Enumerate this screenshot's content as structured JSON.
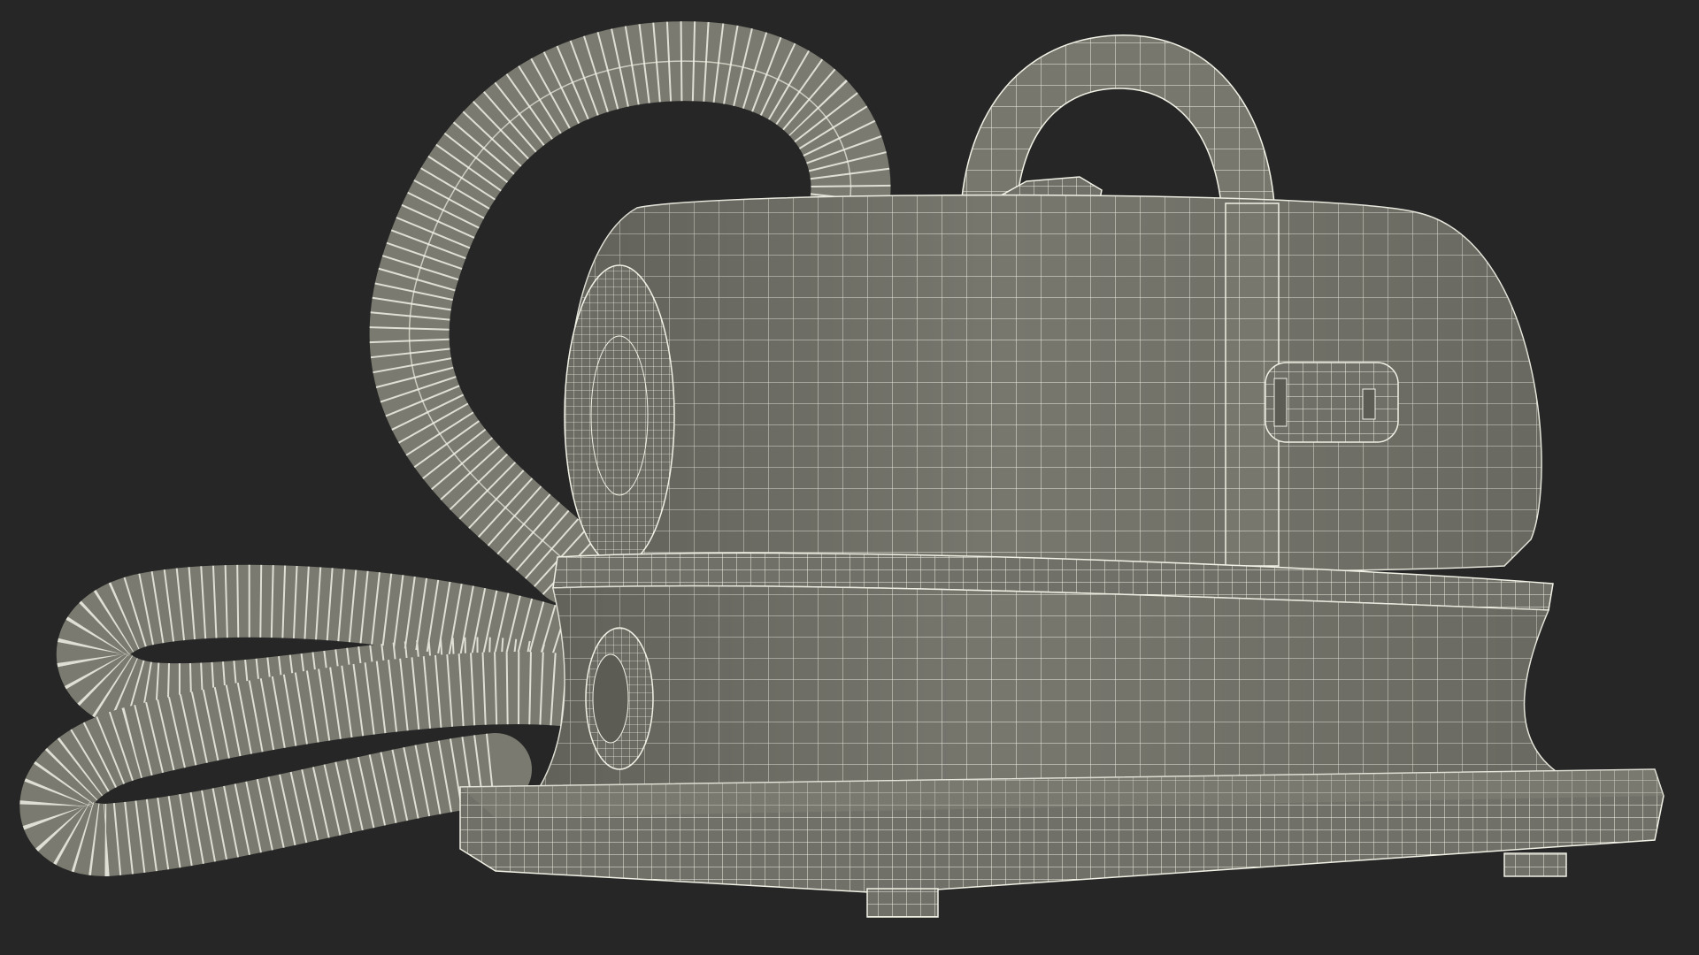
{
  "scene": {
    "subject": "wireframe-pet-grooming-dryer",
    "colors": {
      "background": "#262626",
      "surface": "#77776e",
      "surface_light": "#8a8a80",
      "surface_dark": "#5c5c55",
      "wire": "#f1f1e6"
    },
    "parts": [
      "hose",
      "handle-strap",
      "clip",
      "motor-housing",
      "end-cap",
      "latch-button",
      "base-collar",
      "base-skirt",
      "base-plate",
      "feet",
      "hose-connector"
    ]
  }
}
